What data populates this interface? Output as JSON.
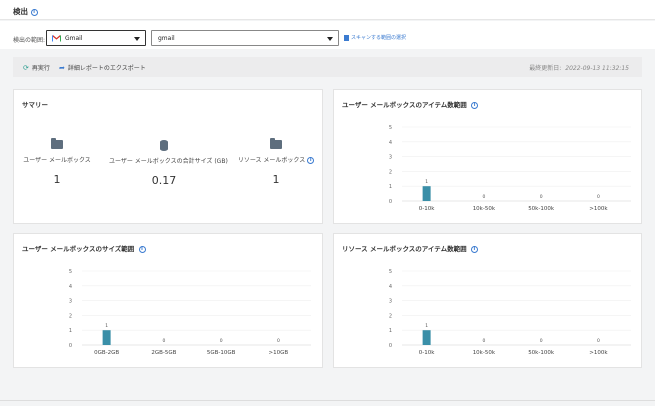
{
  "page": {
    "title": "検出"
  },
  "scope": {
    "label": "検出の範囲:",
    "service_value": "Gmail",
    "target_value": "gmail",
    "scan_link_label": "スキャンする範囲の選択"
  },
  "toolbar": {
    "rerun_label": "再実行",
    "export_label": "詳細レポートのエクスポート",
    "updated_label": "最終更新日:",
    "updated_value": "2022-09-13 11:32:15"
  },
  "summary": {
    "title": "サマリー",
    "items": [
      {
        "label": "ユーザー メールボックス",
        "value": "1",
        "icon": "folder-icon"
      },
      {
        "label": "ユーザー メールボックスの合計サイズ (GB)",
        "value": "0.17",
        "icon": "database-icon"
      },
      {
        "label": "リソース メールボックス",
        "value": "1",
        "icon": "folder-icon"
      }
    ]
  },
  "charts": {
    "user_item_count": {
      "title": "ユーザー メールボックスのアイテム数範囲"
    },
    "user_size": {
      "title": "ユーザー メールボックスのサイズ範囲"
    },
    "resource_item_count": {
      "title": "リソース メールボックスのアイテム数範囲"
    }
  },
  "chart_data": [
    {
      "id": "user_item_count",
      "type": "bar",
      "title": "ユーザー メールボックスのアイテム数範囲",
      "categories": [
        "0-10k",
        "10k-50k",
        "50k-100k",
        ">100k"
      ],
      "values": [
        1,
        0,
        0,
        0
      ],
      "ylim": [
        0,
        5
      ],
      "yticks": [
        0,
        1,
        2,
        3,
        4,
        5
      ],
      "color": "#3a8fa8",
      "grid": true
    },
    {
      "id": "user_size",
      "type": "bar",
      "title": "ユーザー メールボックスのサイズ範囲",
      "categories": [
        "0GB-2GB",
        "2GB-5GB",
        "5GB-10GB",
        ">10GB"
      ],
      "values": [
        1,
        0,
        0,
        0
      ],
      "ylim": [
        0,
        5
      ],
      "yticks": [
        0,
        1,
        2,
        3,
        4,
        5
      ],
      "color": "#3a8fa8",
      "grid": true
    },
    {
      "id": "resource_item_count",
      "type": "bar",
      "title": "リソース メールボックスのアイテム数範囲",
      "categories": [
        "0-10k",
        "10k-50k",
        "50k-100k",
        ">100k"
      ],
      "values": [
        1,
        0,
        0,
        0
      ],
      "ylim": [
        0,
        5
      ],
      "yticks": [
        0,
        1,
        2,
        3,
        4,
        5
      ],
      "color": "#3a8fa8",
      "grid": true
    }
  ]
}
